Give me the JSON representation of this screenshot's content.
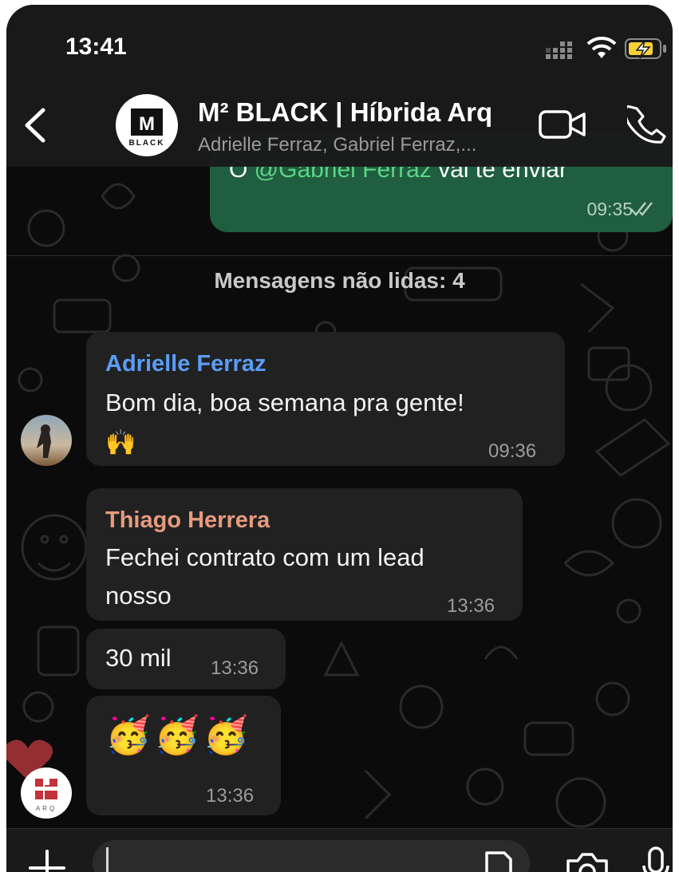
{
  "status_bar": {
    "time": "13:41"
  },
  "chat_header": {
    "title": "M² BLACK | Híbrida Arq",
    "subtitle": "Adrielle Ferraz, Gabriel Ferraz,...",
    "avatar_text": "BLACK"
  },
  "outgoing": {
    "mention": "@Gabriel Ferraz",
    "prefix": "O ",
    "suffix": " vai te enviar",
    "time": "09:35"
  },
  "unread_label": "Mensagens não lidas: 4",
  "messages": [
    {
      "sender": "Adrielle Ferraz",
      "sender_color": "#5b9df5",
      "lines": [
        "Bom dia, boa semana pra gente!",
        "🙌"
      ],
      "time": "09:36"
    },
    {
      "sender": "Thiago Herrera",
      "sender_color": "#e79b7f",
      "lines": [
        "Fechei contrato com um lead",
        "nosso"
      ],
      "time": "13:36"
    },
    {
      "lines": [
        "30 mil"
      ],
      "time": "13:36"
    },
    {
      "lines": [
        "🥳🥳🥳"
      ],
      "time": "13:36"
    }
  ],
  "composer": {
    "placeholder": ""
  },
  "icons": [
    "back-icon",
    "video-call-icon",
    "phone-icon",
    "plus-icon",
    "sticker-icon",
    "camera-icon",
    "microphone-icon",
    "double-check-icon",
    "heart-icon"
  ]
}
